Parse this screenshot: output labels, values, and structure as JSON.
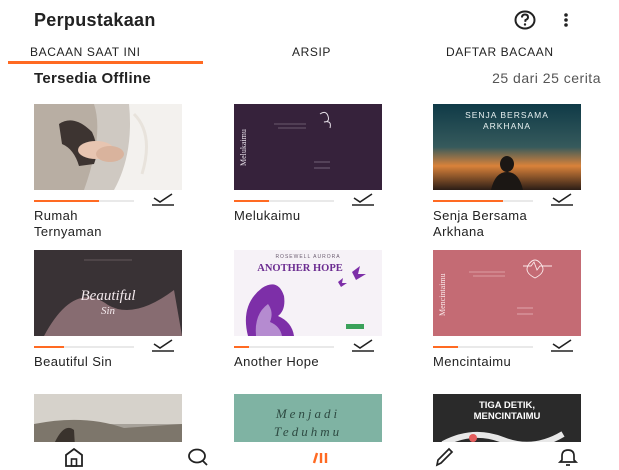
{
  "header": {
    "title": "Perpustakaan",
    "help_icon": "help-circle-icon",
    "more_icon": "more-vertical-icon"
  },
  "tabs": [
    {
      "label": "BACAAN SAAT INI",
      "active": true
    },
    {
      "label": "ARSIP",
      "active": false
    },
    {
      "label": "DAFTAR BACAAN",
      "active": false
    }
  ],
  "section": {
    "title": "Tersedia Offline",
    "count": "25 dari 25 cerita"
  },
  "colors": {
    "accent": "#ff6a22"
  },
  "books": [
    {
      "title": "Rumah\nTernyaman",
      "progress": 0.65,
      "downloaded": true
    },
    {
      "title": "Melukaimu",
      "progress": 0.35,
      "downloaded": true
    },
    {
      "title": "Senja Bersama\nArkhana",
      "progress": 0.7,
      "downloaded": true
    },
    {
      "title": "Beautiful Sin",
      "progress": 0.3,
      "downloaded": true
    },
    {
      "title": "Another Hope",
      "progress": 0.15,
      "downloaded": true
    },
    {
      "title": "Mencintaimu",
      "progress": 0.25,
      "downloaded": true
    },
    {
      "title": "",
      "progress": 0,
      "downloaded": false
    },
    {
      "title": "",
      "progress": 0,
      "downloaded": false
    },
    {
      "title": "",
      "progress": 0,
      "downloaded": false
    }
  ],
  "covers": {
    "melukaimu": {
      "title": "Melukaimu"
    },
    "senja": {
      "title": "SENJA BERSAMA\nARKHANA"
    },
    "beautiful": {
      "title": "Beautiful\nSin"
    },
    "another": {
      "author": "ROSEWELL AURORA",
      "title": "ANOTHER HOPE"
    },
    "mencintaimu": {
      "title": "Mencintaimu"
    },
    "menjadi": {
      "title": "Menjadi\nTeduhmu"
    },
    "tiga": {
      "title": "TIGA DETIK,\nMENCINTAIMU"
    }
  },
  "bottom_nav": [
    {
      "icon": "home-icon"
    },
    {
      "icon": "search-icon"
    },
    {
      "icon": "library-icon",
      "active": true
    },
    {
      "icon": "write-icon"
    },
    {
      "icon": "notifications-icon"
    }
  ]
}
